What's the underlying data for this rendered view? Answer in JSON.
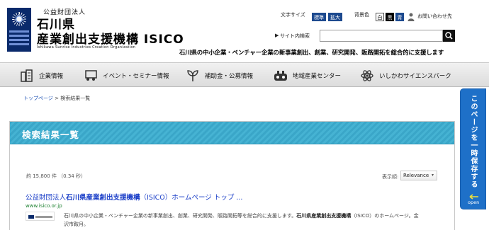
{
  "header": {
    "org_type": "公益財団法人",
    "pref": "石川県",
    "org_name": "産業創出支援機構 ISICO",
    "org_english": "Ishikawa Sunrise Industries Creation Organization",
    "tagline": "石川県の中小企業・ベンチャー企業の新事業創出、創業、研究開発、販路開拓を総合的に支援します",
    "font_size_label": "文字サイズ",
    "font_standard": "標準",
    "font_large": "拡大",
    "bg_color_label": "背景色",
    "bg_white": "白",
    "bg_black": "黒",
    "bg_blue": "青",
    "contact": "お問い合わせ先",
    "search_label": "サイト内検索",
    "search_value": ""
  },
  "nav": {
    "items": [
      {
        "label": "企業情報",
        "icon": "building-icon"
      },
      {
        "label": "イベント・セミナー情報",
        "icon": "seminar-icon"
      },
      {
        "label": "補助金・公募情報",
        "icon": "sprout-icon"
      },
      {
        "label": "地域産業センター",
        "icon": "factory-icon"
      },
      {
        "label": "いしかわサイエンスパーク",
        "icon": "atom-icon"
      }
    ]
  },
  "breadcrumb": {
    "home": "トップページ",
    "separator": ">",
    "current": "検索結果一覧"
  },
  "results": {
    "title": "検索結果一覧",
    "count": "約 15,800 件 （0.34 秒）",
    "sort_label": "表示順:",
    "sort_value": "Relevance",
    "items": [
      {
        "title_prefix": "公益財団法人",
        "title_bold": "石川県産業創出支援機構",
        "title_suffix": "（ISICO）ホームページ トップ ...",
        "url": "www.isico.or.jp",
        "snippet_1": "石川県の中小企業・ベンチャー企業の新事業創出、創業、研究開発、販路開拓等を総合的に支援します。",
        "snippet_bold": "石川県産業創出支援機構",
        "snippet_2": "（ISICO）のホームページ。金",
        "snippet_3": "沢市鞍月。"
      }
    ]
  },
  "side_tab": {
    "label": "このページを一時保存する",
    "open": "open"
  },
  "colors": {
    "brand_navy": "#0a2a6b",
    "panel_blue": "#3aa6c8",
    "side_tab_blue": "#1e70c8",
    "link_blue": "#1a3ec8",
    "url_green": "#1a7f2e"
  }
}
